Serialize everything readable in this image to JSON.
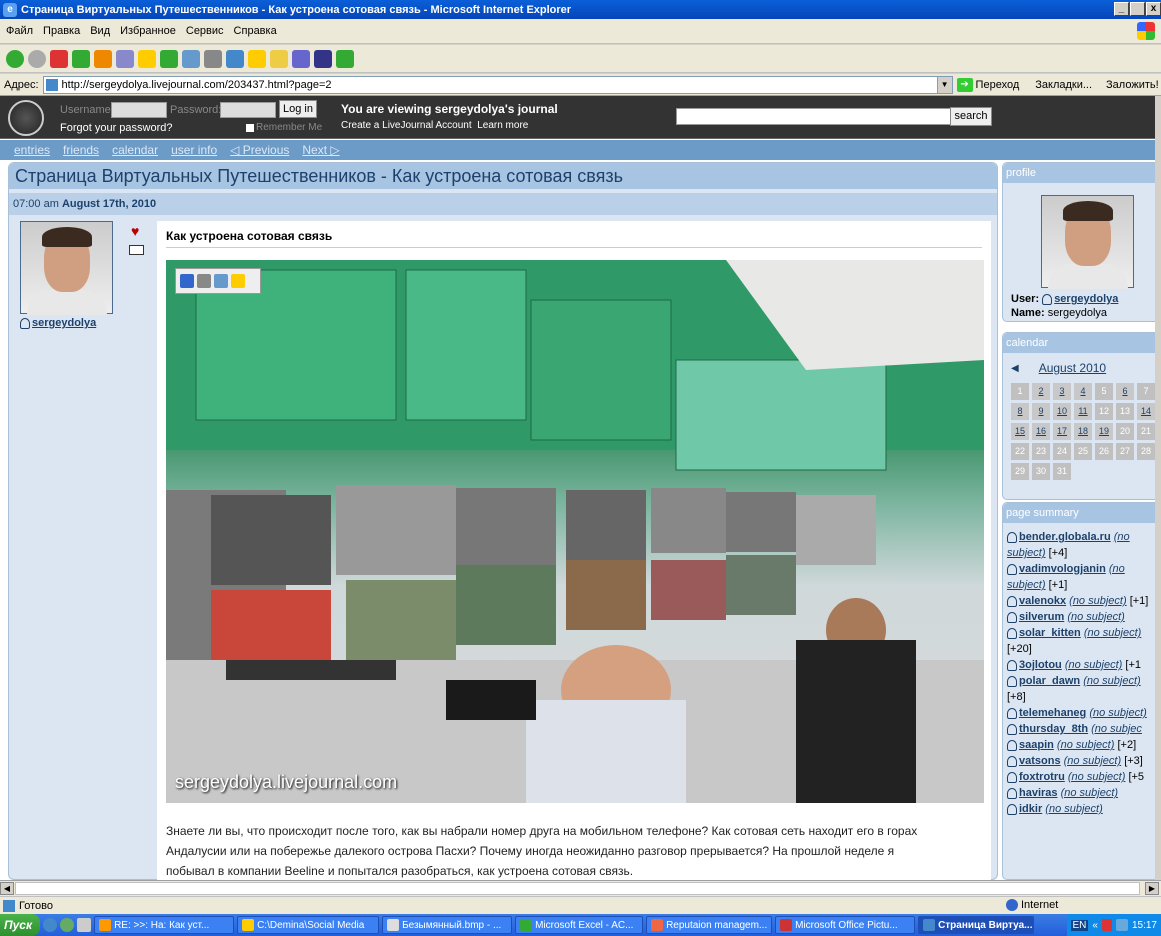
{
  "window": {
    "title": "Страница Виртуальных Путешественников - Как устроена сотовая связь - Microsoft Internet Explorer",
    "buttons": [
      "_",
      " ",
      "x"
    ]
  },
  "menu": [
    "Файл",
    "Правка",
    "Вид",
    "Избранное",
    "Сервис",
    "Справка"
  ],
  "address": {
    "label": "Адрес:",
    "url": "http://sergeydolya.livejournal.com/203437.html?page=2",
    "go": "Переход",
    "bookmarks": "Закладки...",
    "bookmark_add": "Заложить!"
  },
  "lj": {
    "username_label": "Username:",
    "password_label": "Password:",
    "login": "Log in",
    "forgot": "Forgot your password?",
    "remember": "Remember Me",
    "viewing": "You are viewing  sergeydolya's journal",
    "create": "Create a LiveJournal Account",
    "learn": "Learn more",
    "search_btn": "search"
  },
  "nav": [
    "entries",
    "friends",
    "calendar",
    "user info",
    "◁ Previous",
    "Next ▷"
  ],
  "post": {
    "page_title": "Страница Виртуальных Путешественников - Как устроена сотовая связь",
    "time": "07:00 am",
    "date": "August 17th, 2010",
    "user": "sergeydolya",
    "subject": "Как устроена сотовая связь",
    "photo_caption": "sergeydolya.livejournal.com",
    "text1": "Знаете ли вы, что происходит после того, как вы набрали номер друга на мобильном телефоне? Как сотовая сеть находит его в горах",
    "text2": "Андалусии или на побережье далекого острова Пасхи? Почему иногда неожиданно разговор прерывается? На прошлой неделе я",
    "text3": "побывал в компании Beeline и попытался разобраться, как устроена сотовая связь."
  },
  "profile": {
    "header": "profile",
    "user_label": "User:",
    "user": "sergeydolya",
    "name_label": "Name:",
    "name": "sergeydolya"
  },
  "calendar": {
    "header": "calendar",
    "month": "August 2010",
    "days": [
      "1",
      "2",
      "3",
      "4",
      "5",
      "6",
      "7",
      "8",
      "9",
      "10",
      "11",
      "12",
      "13",
      "14",
      "15",
      "16",
      "17",
      "18",
      "19",
      "20",
      "21",
      "22",
      "23",
      "24",
      "25",
      "26",
      "27",
      "28",
      "29",
      "30",
      "31"
    ]
  },
  "summary": {
    "header": "page summary",
    "entries": [
      {
        "user": "bender.globala.ru",
        "subj": "(no subject)",
        "count": "[+4]"
      },
      {
        "user": "vadimvologjanin",
        "subj": "(no subject)",
        "count": "[+1]"
      },
      {
        "user": "valenokx",
        "subj": "(no subject)",
        "count": "[+1]"
      },
      {
        "user": "silverum",
        "subj": "(no subject)",
        "count": ""
      },
      {
        "user": "solar_kitten",
        "subj": "(no subject)",
        "count": "[+20]"
      },
      {
        "user": "3ojlotou",
        "subj": "(no subject)",
        "count": "[+1"
      },
      {
        "user": "polar_dawn",
        "subj": "(no subject)",
        "count": "[+8]"
      },
      {
        "user": "telemehaneg",
        "subj": "(no subject)",
        "count": ""
      },
      {
        "user": "thursday_8th",
        "subj": "(no subjec",
        "count": ""
      },
      {
        "user": "saapin",
        "subj": "(no subject)",
        "count": "[+2]"
      },
      {
        "user": "vatsons",
        "subj": "(no subject)",
        "count": "[+3]"
      },
      {
        "user": "foxtrotru",
        "subj": "(no subject)",
        "count": "[+5"
      },
      {
        "user": "haviras",
        "subj": "(no subject)",
        "count": ""
      },
      {
        "user": "idkir",
        "subj": "(no subject)",
        "count": ""
      }
    ]
  },
  "status": {
    "text": "Готово",
    "zone": "Internet"
  },
  "taskbar": {
    "start": "Пуск",
    "tasks": [
      "RE: >>: На: Как уст...",
      "C:\\Demina\\Social Media",
      "Безымянный.bmp - ...",
      "Microsoft Excel - AC...",
      "Reputaion managem...",
      "Microsoft Office Pictu...",
      "Страница Виртуа..."
    ],
    "lang": "EN",
    "clock": "15:17"
  }
}
